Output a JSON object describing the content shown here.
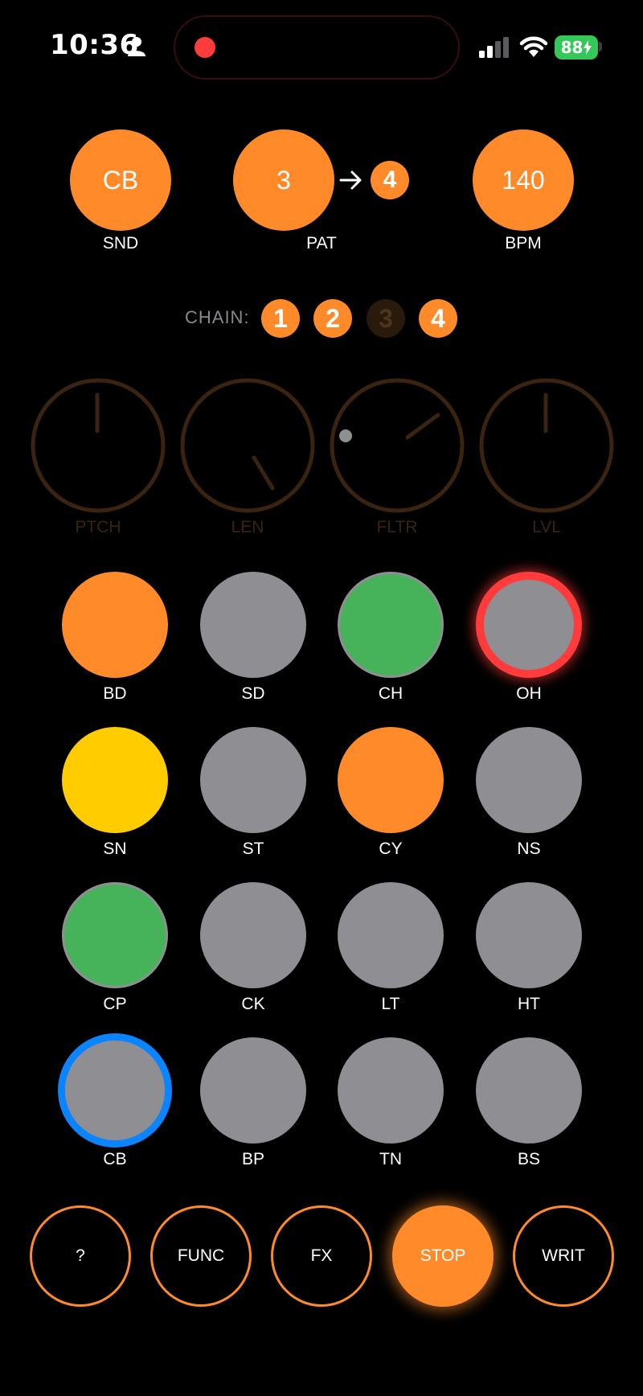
{
  "status_bar": {
    "time": "10:36",
    "battery": "88"
  },
  "top": {
    "sound": {
      "value": "CB",
      "label": "SND"
    },
    "pattern": {
      "value": "3",
      "next": "4",
      "label": "PAT"
    },
    "bpm": {
      "value": "140",
      "label": "BPM"
    }
  },
  "chain": {
    "label": "CHAIN:",
    "items": [
      {
        "label": "1",
        "active": true
      },
      {
        "label": "2",
        "active": true
      },
      {
        "label": "3",
        "active": false
      },
      {
        "label": "4",
        "active": true
      }
    ]
  },
  "knobs": [
    {
      "label": "PTCH"
    },
    {
      "label": "LEN"
    },
    {
      "label": "FLTR"
    },
    {
      "label": "LVL"
    }
  ],
  "pads": [
    {
      "label": "BD"
    },
    {
      "label": "SD"
    },
    {
      "label": "CH"
    },
    {
      "label": "OH"
    },
    {
      "label": "SN"
    },
    {
      "label": "ST"
    },
    {
      "label": "CY"
    },
    {
      "label": "NS"
    },
    {
      "label": "CP"
    },
    {
      "label": "CK"
    },
    {
      "label": "LT"
    },
    {
      "label": "HT"
    },
    {
      "label": "CB"
    },
    {
      "label": "BP"
    },
    {
      "label": "TN"
    },
    {
      "label": "BS"
    }
  ],
  "controls": [
    {
      "label": "?"
    },
    {
      "label": "FUNC"
    },
    {
      "label": "FX"
    },
    {
      "label": "STOP"
    },
    {
      "label": "WRIT"
    }
  ],
  "colors": {
    "accent": "#ff8a2a",
    "pad_gray": "#8e8e93",
    "green": "#46b35a",
    "yellow": "#ffcc00",
    "recording_red": "#ff3b3b",
    "selected_blue": "#0a84ff",
    "knob_brown": "#3a2410"
  }
}
